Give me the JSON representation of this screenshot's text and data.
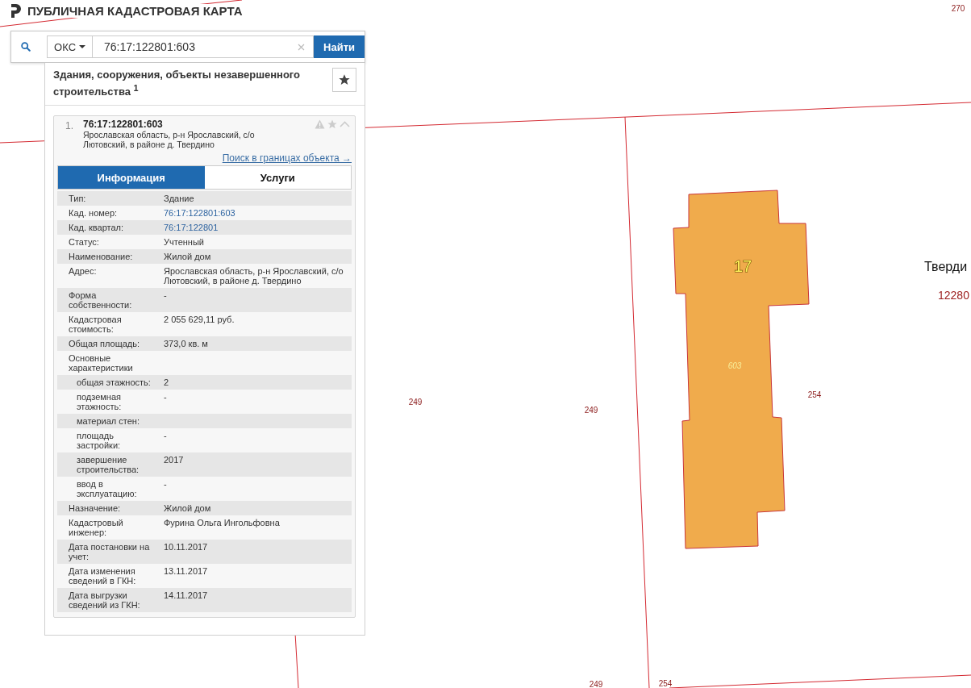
{
  "header": {
    "title": "ПУБЛИЧНАЯ КАДАСТРОВАЯ КАРТА"
  },
  "search": {
    "type": "ОКС",
    "value": "76:17:122801:603",
    "button": "Найти"
  },
  "results": {
    "category": "Здания, сооружения, объекты незавершенного строительства $^{1}$",
    "item": {
      "number": "1.",
      "cadastral_number": "76:17:122801:603",
      "address": "Ярославская область, р-н Ярославский, с/о Лютовский, в районе д. Твердино",
      "link": "Поиск в границах объекта →"
    },
    "tabs": [
      {
        "label": "Информация",
        "selected": true
      },
      {
        "label": "Услуги",
        "selected": false
      }
    ],
    "rows": [
      {
        "label": "Тип:",
        "value": "Здание",
        "kind": "text"
      },
      {
        "label": "Кад. номер:",
        "value": "76:17:122801:603",
        "kind": "link"
      },
      {
        "label": "Кад. квартал:",
        "value": "76:17:122801",
        "kind": "link"
      },
      {
        "label": "Статус:",
        "value": "Учтенный",
        "kind": "text"
      },
      {
        "label": "Наименование:",
        "value": "Жилой дом",
        "kind": "text"
      },
      {
        "label": "Адрес:",
        "value": "Ярославская область, р-н Ярославский, с/о Лютовский, в районе д. Твердино",
        "kind": "text"
      },
      {
        "label": "Форма собственности:",
        "value": "-",
        "kind": "text"
      },
      {
        "label": "Кадастровая стоимость:",
        "value": "2 055 629,11 руб.",
        "kind": "text"
      },
      {
        "label": "Общая площадь:",
        "value": "373,0 кв. м",
        "kind": "text"
      },
      {
        "label": "Основные характеристики",
        "children": [
          {
            "label": "общая этажность:",
            "value": "2"
          },
          {
            "label": "подземная этажность:",
            "value": "-"
          },
          {
            "label": "материал стен:"
          },
          {
            "label": "площадь застройки:",
            "value": "-"
          },
          {
            "label": "завершение строительства:",
            "value": "2017"
          },
          {
            "label": "ввод в эксплуатацию:",
            "value": "-"
          }
        ]
      },
      {
        "label": "Назначение:",
        "value": "Жилой дом",
        "kind": "text"
      },
      {
        "label": "Кадастровый инженер:",
        "value": "Фурина Ольга Ингольфовна",
        "kind": "text"
      },
      {
        "label": "Дата постановки на учет:",
        "value": "10.11.2017",
        "kind": "text"
      },
      {
        "label": "Дата изменения сведений в ГКН:",
        "value": "13.11.2017",
        "kind": "text"
      },
      {
        "label": "Дата выгрузки сведений из ГКН:",
        "value": "14.11.2017",
        "kind": "text"
      }
    ]
  },
  "map": {
    "building_labels": [
      "17",
      "603"
    ],
    "labels": [
      "270",
      "249",
      "249",
      "254",
      "249",
      "254"
    ],
    "place_labels": [
      "Тверди",
      "12280"
    ]
  }
}
